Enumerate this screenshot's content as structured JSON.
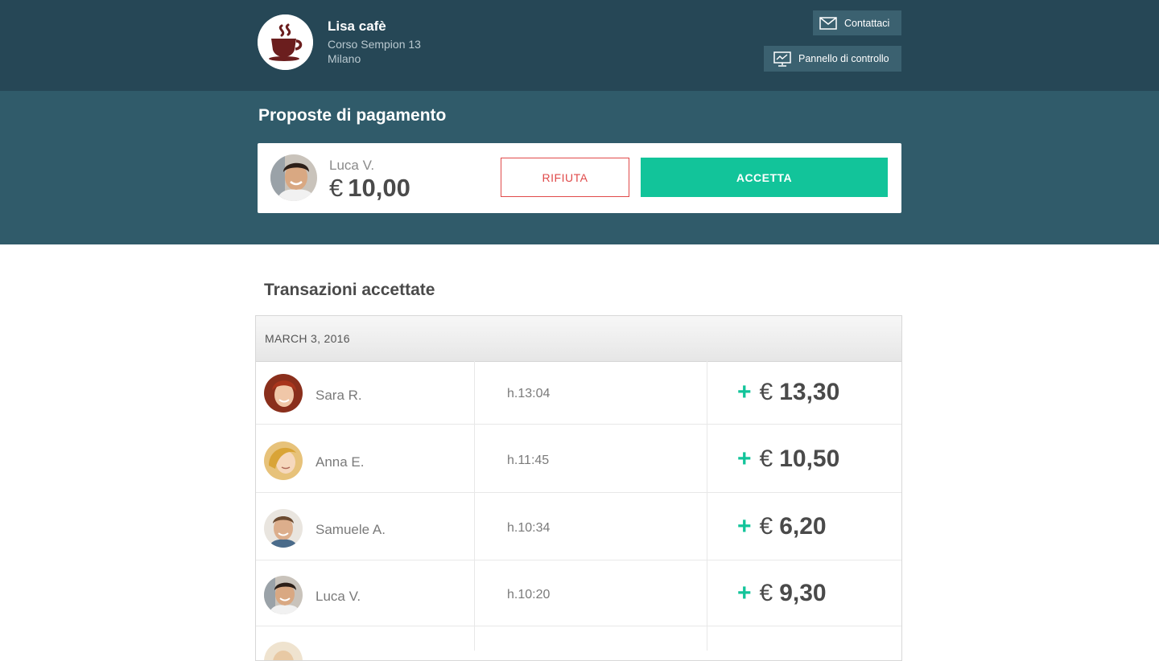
{
  "header": {
    "cafe_name": "Lisa cafè",
    "address_line1": "Corso Sempion 13",
    "address_line2": "Milano",
    "contact_label": "Contattaci",
    "panel_label": "Pannello di controllo",
    "contact_icon": "envelope-icon",
    "panel_icon": "monitor-chart-icon",
    "logo_icon": "coffee-cup-icon"
  },
  "proposals": {
    "title": "Proposte di pagamento",
    "item": {
      "name": "Luca V.",
      "currency": "€",
      "amount": "10,00",
      "reject_label": "RIFIUTA",
      "accept_label": "ACCETTA"
    }
  },
  "transactions": {
    "title": "Transazioni accettate",
    "date": "MARCH 3, 2016",
    "rows": [
      {
        "name": "Sara R.",
        "time": "h.13:04",
        "sign": "+",
        "currency": "€",
        "amount": "13,30"
      },
      {
        "name": "Anna E.",
        "time": "h.11:45",
        "sign": "+",
        "currency": "€",
        "amount": "10,50"
      },
      {
        "name": "Samuele A.",
        "time": "h.10:34",
        "sign": "+",
        "currency": "€",
        "amount": "6,20"
      },
      {
        "name": "Luca V.",
        "time": "h.10:20",
        "sign": "+",
        "currency": "€",
        "amount": "9,30"
      }
    ]
  },
  "colors": {
    "header_bg": "#264756",
    "band_bg": "#305b6a",
    "accept_green": "#12c49a",
    "reject_red": "#e04a4a"
  }
}
